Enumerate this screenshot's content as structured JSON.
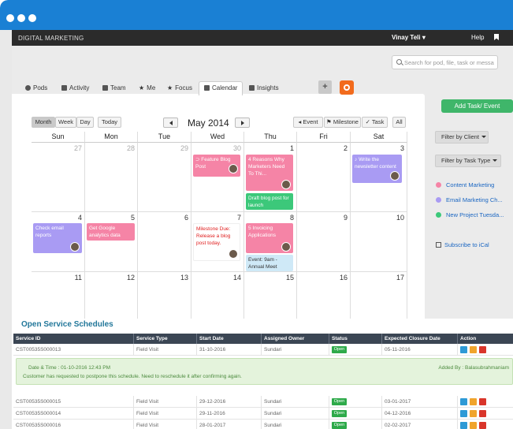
{
  "app": {
    "brand": "DIGITAL MARKETING",
    "user": "Vinay Teli",
    "help": "Help"
  },
  "search": {
    "placeholder": "Search for pod, file, task or messa"
  },
  "tabs": [
    {
      "label": "Pods",
      "icon": "pod-icon"
    },
    {
      "label": "Activity",
      "icon": "activity-icon"
    },
    {
      "label": "Team",
      "icon": "team-icon"
    },
    {
      "label": "Me",
      "icon": "star-icon"
    },
    {
      "label": "Focus",
      "icon": "focus-icon"
    },
    {
      "label": "Calendar",
      "icon": "calendar-icon"
    },
    {
      "label": "Insights",
      "icon": "insights-icon"
    }
  ],
  "active_tab": "Calendar",
  "plus_label": "+",
  "calendar": {
    "views": [
      "Month",
      "Week",
      "Day"
    ],
    "today": "Today",
    "title": "May 2014",
    "actions": {
      "event": "Event",
      "milestone": "Milestone",
      "task": "Task",
      "all": "All"
    },
    "weekdays": [
      "Sun",
      "Mon",
      "Tue",
      "Wed",
      "Thu",
      "Fri",
      "Sat"
    ],
    "weeks": [
      [
        "27",
        "28",
        "29",
        "30",
        "1",
        "2",
        "3"
      ],
      [
        "4",
        "5",
        "6",
        "7",
        "8",
        "9",
        "10"
      ],
      [
        "11",
        "12",
        "13",
        "14",
        "15",
        "16",
        "17"
      ]
    ],
    "events": {
      "wed1": "Feature Blog Post",
      "thu1": "4 Reasons Why Marketers Need To Thi...",
      "thu1b": "Draft blog post for launch",
      "sat1": "Write the newsletter content",
      "sun2": "Check email reports",
      "mon2": "Get Google analytics data",
      "wed2": "Milestone Due: Release a blog post today.",
      "thu2": "5 Invoicing Applications",
      "thu2b": "Event: 9am - Annual Meet"
    }
  },
  "sidebar": {
    "add_task": "Add Task/ Event",
    "filter_client": "Filter by Client",
    "filter_task": "Filter by Task Type",
    "legend": [
      {
        "label": "Content Marketing",
        "color": "#f584a6"
      },
      {
        "label": "Email Marketing Ch...",
        "color": "#a99bf3"
      },
      {
        "label": "New Project Tuesda...",
        "color": "#3cc87a"
      }
    ],
    "subscribe": "Subscribe to iCal"
  },
  "schedules": {
    "title": "Open Service Schedules",
    "columns": [
      "Service ID",
      "Service Type",
      "Start Date",
      "Assigned Owner",
      "Status",
      "Expected Closure Date",
      "Action"
    ],
    "rows": [
      [
        "CST00535S000013",
        "Field Visit",
        "31-10-2016",
        "Sundari",
        "Open",
        "05-11-2016"
      ],
      [
        "CST00535S000015",
        "Field Visit",
        "29-12-2016",
        "Sundari",
        "Open",
        "03-01-2017"
      ],
      [
        "CST00535S000014",
        "Field Visit",
        "29-11-2016",
        "Sundari",
        "Open",
        "04-12-2016"
      ],
      [
        "CST00535S000016",
        "Field Visit",
        "28-01-2017",
        "Sundari",
        "Open",
        "02-02-2017"
      ]
    ],
    "note": {
      "datetime": "Date & Time : 01-10-2016 12:43 PM",
      "added_by": "Added By : Balasubrahmaniam",
      "message": "Customer has requested to postpone this schedule. Need to reschedule it after confirming again."
    }
  }
}
